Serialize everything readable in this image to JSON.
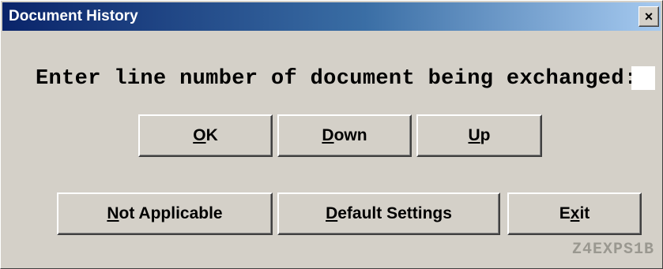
{
  "window": {
    "title": "Document History",
    "close_glyph": "×"
  },
  "prompt": {
    "label": "Enter line number of document being exchanged:",
    "input_value": ""
  },
  "buttons": {
    "ok": {
      "accel": "O",
      "rest": "K"
    },
    "down": {
      "accel": "D",
      "rest": "own"
    },
    "up": {
      "accel": "U",
      "rest": "p"
    },
    "not_applicable": {
      "accel": "N",
      "rest": "ot Applicable"
    },
    "default_settings": {
      "accel": "D",
      "rest": "efault Settings"
    },
    "exit": {
      "pre": "E",
      "accel": "x",
      "rest": "it"
    }
  },
  "screen_id": "Z4EXPS1B"
}
